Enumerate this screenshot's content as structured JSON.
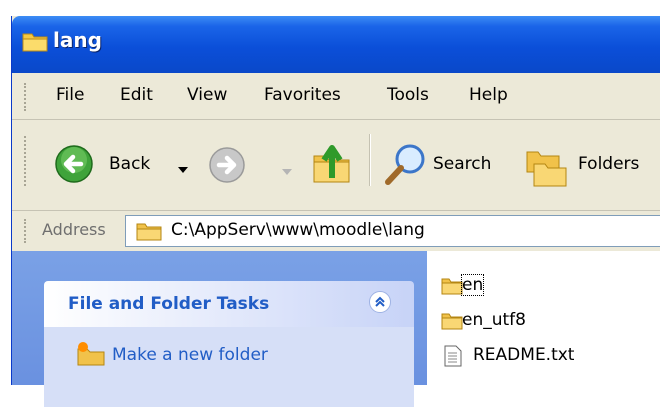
{
  "window": {
    "title": "lang"
  },
  "menu": [
    "File",
    "Edit",
    "View",
    "Favorites",
    "Tools",
    "Help"
  ],
  "toolbar": {
    "back_label": "Back",
    "search_label": "Search",
    "folders_label": "Folders"
  },
  "address": {
    "label": "Address",
    "path": "C:\\AppServ\\www\\moodle\\lang"
  },
  "tasks": {
    "title": "File and Folder Tasks",
    "items": [
      "Make a new folder"
    ]
  },
  "files": [
    {
      "name": "en",
      "type": "folder"
    },
    {
      "name": "en_utf8",
      "type": "folder"
    },
    {
      "name": "README.txt",
      "type": "text-file"
    }
  ],
  "icons": {
    "title": "folder-icon",
    "back": "back-arrow-icon",
    "forward": "forward-arrow-icon",
    "up": "up-folder-icon",
    "search": "magnifier-icon",
    "folders": "folders-icon",
    "collapse": "chevron-up-icon"
  },
  "colors": {
    "titlebar": "#0b4fd9",
    "taskpane": "#6a91e0",
    "task_link": "#215dc6"
  }
}
